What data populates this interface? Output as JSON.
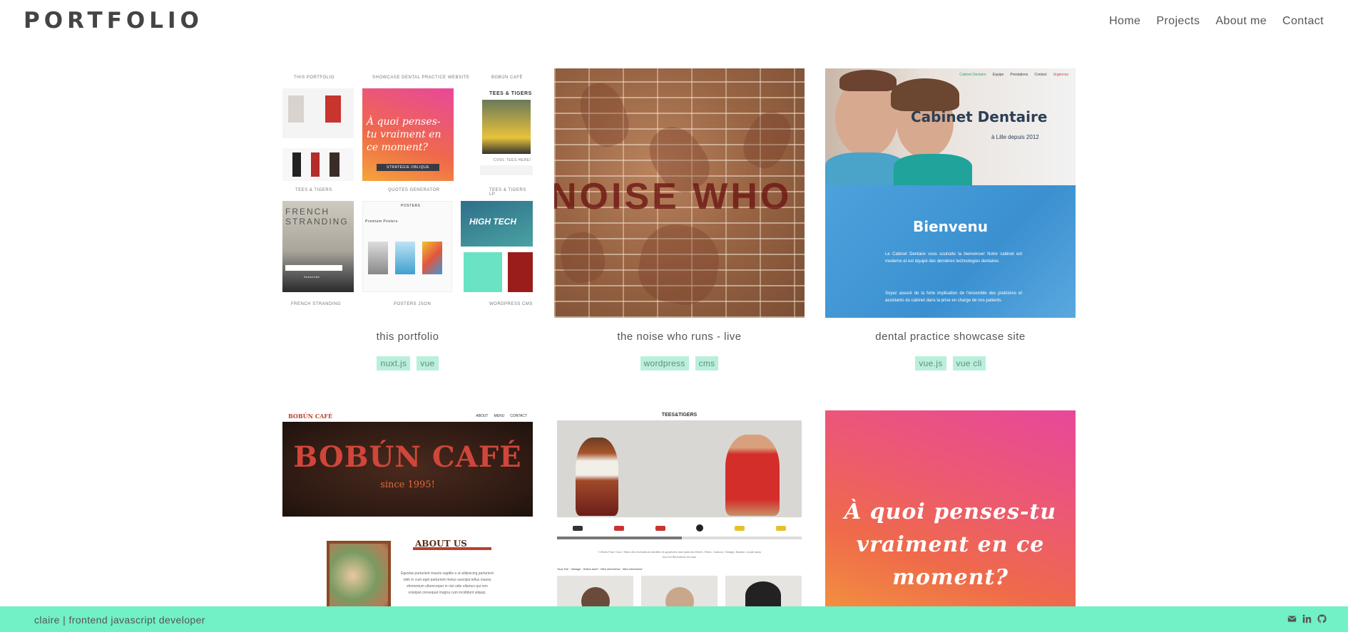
{
  "header": {
    "logo": "PORTFOLIO",
    "nav": [
      "Home",
      "Projects",
      "About me",
      "Contact"
    ]
  },
  "projects": [
    {
      "title": "this portfolio",
      "tags": [
        "nuxt.js",
        "vue"
      ],
      "thumb": {
        "labels": [
          "THIS PORTFOLIO",
          "SHOWCASE DENTAL PRACTICE WEBSITE",
          "BOBÚN CAFÉ",
          "TEES & TIGERS",
          "QUOTES GENERATOR",
          "TEES & TIGERS LP",
          "FRENCH STRANDING",
          "POSTERS JSON",
          "WORDPRESS CMS"
        ],
        "quote": "À quoi penses-tu vraiment en ce moment?",
        "quote_button": "STRATÉGIE OBLIQUE",
        "tees_title": "TEES & TIGERS",
        "tees_sub": "COOL TEES HERE!",
        "french": "FRENCH STRANDING",
        "subscribe": "Subscribe",
        "high_tech": "HIGH TECH",
        "posters": "POSTERS",
        "premium_posters": "Premium Posters"
      }
    },
    {
      "title": "the noise who runs - live",
      "tags": [
        "wordpress",
        "cms"
      ],
      "thumb": {
        "text": "NOISE WHO R"
      }
    },
    {
      "title": "dental practice showcase site",
      "tags": [
        "vue.js",
        "vue cli"
      ],
      "thumb": {
        "nav": [
          "Cabinet Dentaire",
          "Equipe",
          "Prestations",
          "Contact",
          "Urgences"
        ],
        "title": "Cabinet Dentaire",
        "subtitle": "à Lille depuis 2012",
        "welcome": "Bienvenu",
        "para1": "Le Cabinet Dentaire vous souhaite la bienvenue! Notre cabinet est moderne et est équipé des dernières technologies dentaires",
        "para2": "Soyez assuré de la forte implication de l'ensemble des praticiens et assistants du cabinet dans la prise en charge de nos patients."
      }
    },
    {
      "title": "",
      "tags": [],
      "thumb": {
        "brand": "BOBÚN CAFÉ",
        "nav": [
          "ABOUT",
          "MENU",
          "CONTACT"
        ],
        "hero": "BOBÚN CAFÉ",
        "since": "since 1995!",
        "about": "ABOUT US",
        "about_text": "Egestas parturient mauris sagittis a ut adipiscing parturient nibh in cum eget parturient metus suscipia tellus massa elementum ullamcorper in nisi odio ullamco qui non volutpat consequat magna cum incididunt aliquip."
      }
    },
    {
      "title": "",
      "tags": [],
      "thumb": {
        "brand": "TEES&TIGERS",
        "caption": "T-Shirts Pour Tous ! Sites des revendeurs habillés et appréciés tout dans les Merch, Retro, Cartoon, Vintage, Baston, la joie dans tout ici! Bienvenue en bas!",
        "crumb": "Tous Tee · Vintage · Hellos tout!! · Men s/l/m/xl/xxl · Men s/l/m/xl/xxl"
      }
    },
    {
      "title": "",
      "tags": [],
      "thumb": {
        "quote": "À quoi penses-tu vraiment en ce moment?"
      }
    }
  ],
  "footer": {
    "text": "claire  | frontend javascript developer",
    "icons": [
      "envelope-icon",
      "linkedin-icon",
      "github-icon"
    ]
  },
  "colors": {
    "footer_bg": "#72f0c6",
    "tag_bg": "#b8f0db",
    "text": "#444444"
  }
}
